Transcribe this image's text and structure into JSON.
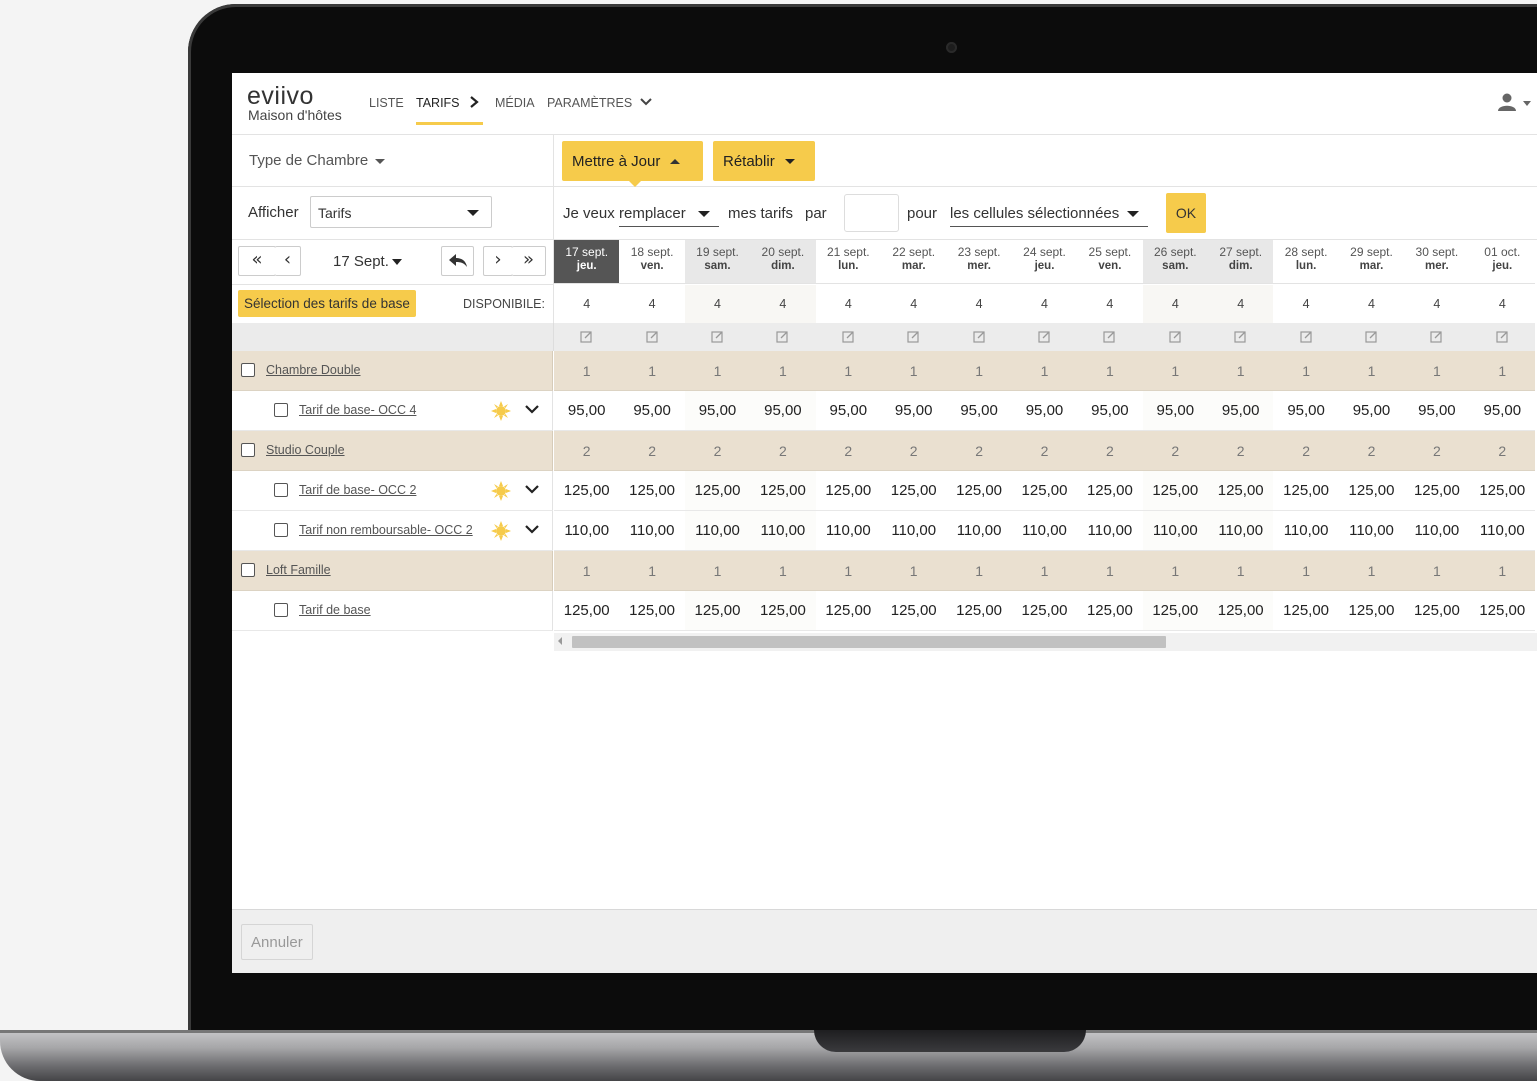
{
  "app": {
    "logo": "eviivo",
    "subtitle": "Maison d'hôtes",
    "nav": {
      "liste": "LISTE",
      "tarifs": "TARIFS",
      "media": "MÉDIA",
      "parametres": "PARAMÈTRES"
    }
  },
  "toolbar": {
    "room_type": "Type de Chambre",
    "update_button": "Mettre à Jour",
    "reset_button": "Rétablir"
  },
  "filter": {
    "afficher_label": "Afficher",
    "afficher_value": "Tarifs",
    "sentence_start": "Je veux",
    "action_value": "remplacer",
    "sentence_mid": "mes tarifs",
    "par": "par",
    "value_input": "",
    "pour": "pour",
    "target_value": "les cellules sélectionnées",
    "ok_button": "OK"
  },
  "date_nav": {
    "current_date": "17 Sept."
  },
  "base_rates_button": "Sélection des tarifs de base",
  "available_label": "DISPONIBILE:",
  "dates": [
    {
      "date": "17 sept.",
      "day": "jeu."
    },
    {
      "date": "18 sept.",
      "day": "ven."
    },
    {
      "date": "19 sept.",
      "day": "sam."
    },
    {
      "date": "20 sept.",
      "day": "dim."
    },
    {
      "date": "21 sept.",
      "day": "lun."
    },
    {
      "date": "22 sept.",
      "day": "mar."
    },
    {
      "date": "23 sept.",
      "day": "mer."
    },
    {
      "date": "24 sept.",
      "day": "jeu."
    },
    {
      "date": "25 sept.",
      "day": "ven."
    },
    {
      "date": "26 sept.",
      "day": "sam."
    },
    {
      "date": "27 sept.",
      "day": "dim."
    },
    {
      "date": "28 sept.",
      "day": "lun."
    },
    {
      "date": "29 sept.",
      "day": "mar."
    },
    {
      "date": "30 sept.",
      "day": "mer."
    },
    {
      "date": "01 oct.",
      "day": "jeu."
    }
  ],
  "availability": [
    "4",
    "4",
    "4",
    "4",
    "4",
    "4",
    "4",
    "4",
    "4",
    "4",
    "4",
    "4",
    "4",
    "4",
    "4"
  ],
  "rows": [
    {
      "type": "group",
      "name": "Chambre Double",
      "value": "1"
    },
    {
      "type": "rate",
      "name": "Tarif de base- OCC 4",
      "value": "95,00",
      "icons": true
    },
    {
      "type": "group",
      "name": "Studio Couple",
      "value": "2"
    },
    {
      "type": "rate",
      "name": "Tarif de base- OCC 2",
      "value": "125,00",
      "icons": true
    },
    {
      "type": "rate",
      "name": "Tarif non remboursable- OCC 2",
      "value": "110,00",
      "icons": true
    },
    {
      "type": "group",
      "name": "Loft Famille",
      "value": "1"
    },
    {
      "type": "rate",
      "name": "Tarif de base",
      "value": "125,00",
      "icons": false
    }
  ],
  "footer": {
    "cancel_button": "Annuler"
  },
  "colors": {
    "accent": "#f6cb4b",
    "group_row": "#eae0d0",
    "today_header": "#555555"
  },
  "icons": [
    "user-icon",
    "edit-icon",
    "sun-icon",
    "chevron-down-icon"
  ]
}
